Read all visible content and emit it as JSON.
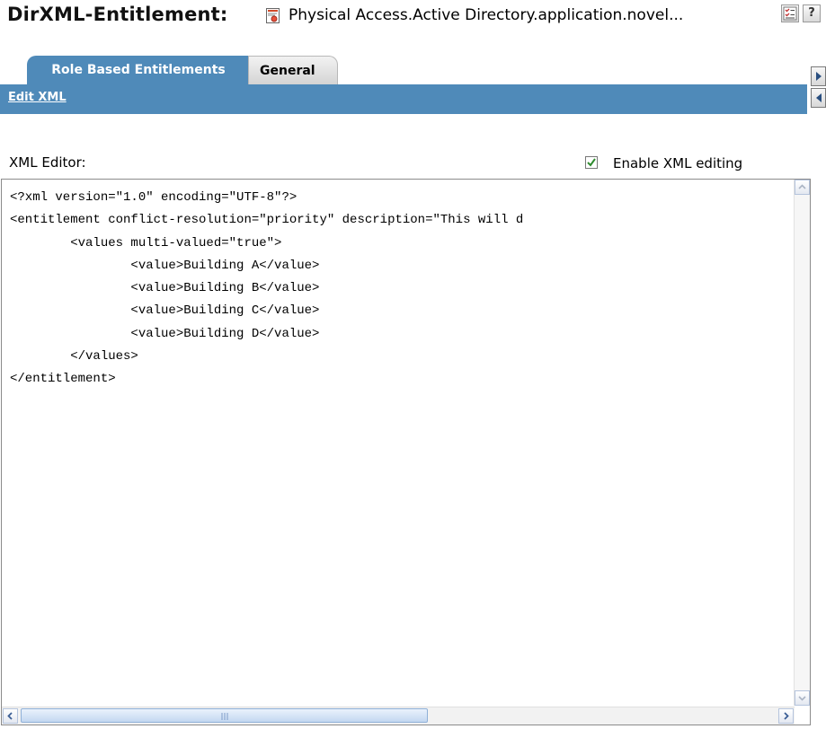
{
  "header": {
    "title": "DirXML-Entitlement:",
    "object_name": "Physical Access.Active Directory.application.novel...",
    "toolbar_icons": [
      "checklist-icon",
      "help-icon"
    ],
    "help_label": "?"
  },
  "tabs": [
    {
      "label": "Role Based Entitlements",
      "active": true
    },
    {
      "label": "General",
      "active": false
    }
  ],
  "subnav": {
    "edit_xml_label": "Edit XML",
    "side_icons": [
      "arrow-right-icon",
      "arrow-left-icon"
    ]
  },
  "editor": {
    "label": "XML Editor:",
    "enable_checkbox_label": "Enable XML editing",
    "enable_checked": true,
    "lines": [
      "<?xml version=\"1.0\" encoding=\"UTF-8\"?>",
      "<entitlement conflict-resolution=\"priority\" description=\"This will d",
      "        <values multi-valued=\"true\">",
      "                <value>Building A</value>",
      "                <value>Building B</value>",
      "                <value>Building C</value>",
      "                <value>Building D</value>",
      "        </values>",
      "</entitlement>"
    ]
  },
  "colors": {
    "accent_blue": "#4f8ab9",
    "checkbox_check": "#2e8b2e"
  }
}
